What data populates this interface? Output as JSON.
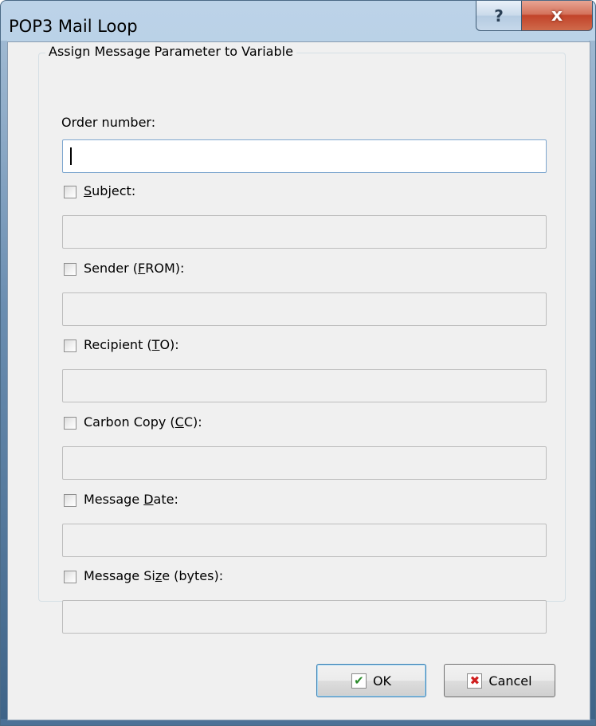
{
  "window": {
    "title": "POP3 Mail Loop",
    "help_label": "?",
    "close_label": "x"
  },
  "group": {
    "title": "Assign Message Parameter to Variable"
  },
  "order": {
    "label": "Order number:",
    "value": ""
  },
  "fields": [
    {
      "pre": "",
      "u": "S",
      "post": "ubject:",
      "checked": false,
      "value": ""
    },
    {
      "pre": "Sender (",
      "u": "F",
      "post": "ROM):",
      "checked": false,
      "value": ""
    },
    {
      "pre": "Recipient (",
      "u": "T",
      "post": "O):",
      "checked": false,
      "value": ""
    },
    {
      "pre": "Carbon Copy (",
      "u": "C",
      "post": "C):",
      "checked": false,
      "value": ""
    },
    {
      "pre": "Message ",
      "u": "D",
      "post": "ate:",
      "checked": false,
      "value": ""
    },
    {
      "pre": "Message Si",
      "u": "z",
      "post": "e (bytes):",
      "checked": false,
      "value": ""
    }
  ],
  "buttons": {
    "ok_label": "OK",
    "cancel_label": "Cancel",
    "ok_icon": "checkmark-icon",
    "cancel_icon": "red-x-icon"
  },
  "colors": {
    "ok_check": "#2a8a2a",
    "cancel_x": "#d02020",
    "close_button": "#c2442a"
  }
}
